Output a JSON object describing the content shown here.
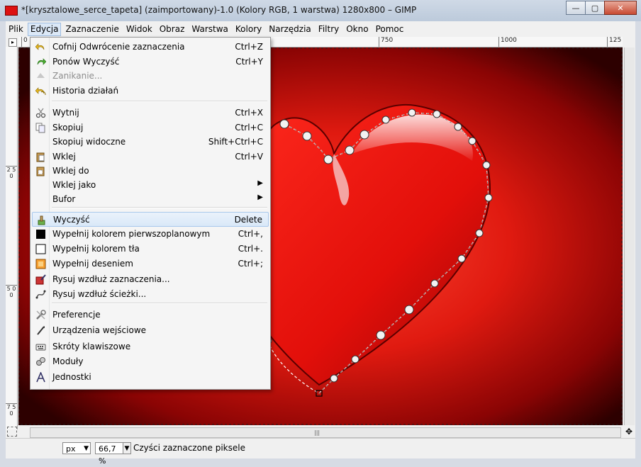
{
  "window": {
    "title": "*[krysztalowe_serce_tapeta] (zaimportowany)-1.0 (Kolory RGB, 1 warstwa) 1280x800 – GIMP",
    "buttons": {
      "minimize": "—",
      "maximize": "▢",
      "close": "✕"
    }
  },
  "menubar": [
    "Plik",
    "Edycja",
    "Zaznaczenie",
    "Widok",
    "Obraz",
    "Warstwa",
    "Kolory",
    "Narzędzia",
    "Filtry",
    "Okno",
    "Pomoc"
  ],
  "rulers": {
    "horizontal": [
      "0",
      "750",
      "1000",
      "125"
    ],
    "vertical": [
      "2 5 0",
      "5 0 0",
      "7 5 0"
    ]
  },
  "edit_menu": {
    "groups": [
      [
        {
          "label": "Cofnij Odwrócenie zaznaczenia",
          "shortcut": "Ctrl+Z",
          "icon": "undo-icon"
        },
        {
          "label": "Ponów Wyczyść",
          "shortcut": "Ctrl+Y",
          "icon": "redo-icon"
        },
        {
          "label": "Zanikanie...",
          "shortcut": "",
          "icon": "fade-icon",
          "disabled": true
        },
        {
          "label": "Historia działań",
          "shortcut": "",
          "icon": "history-icon"
        }
      ],
      [
        {
          "label": "Wytnij",
          "shortcut": "Ctrl+X",
          "icon": "cut-icon"
        },
        {
          "label": "Skopiuj",
          "shortcut": "Ctrl+C",
          "icon": "copy-icon"
        },
        {
          "label": "Skopiuj widoczne",
          "shortcut": "Shift+Ctrl+C",
          "icon": ""
        },
        {
          "label": "Wklej",
          "shortcut": "Ctrl+V",
          "icon": "paste-icon"
        },
        {
          "label": "Wklej do",
          "shortcut": "",
          "icon": "paste-into-icon"
        },
        {
          "label": "Wklej jako",
          "shortcut": "",
          "icon": "",
          "submenu": true
        },
        {
          "label": "Bufor",
          "shortcut": "",
          "icon": "",
          "submenu": true
        }
      ],
      [
        {
          "label": "Wyczyść",
          "shortcut": "Delete",
          "icon": "clear-icon",
          "highlighted": true
        },
        {
          "label": "Wypełnij kolorem pierwszoplanowym",
          "shortcut": "Ctrl+,",
          "icon": "fill-fg-icon"
        },
        {
          "label": "Wypełnij kolorem tła",
          "shortcut": "Ctrl+.",
          "icon": "fill-bg-icon"
        },
        {
          "label": "Wypełnij deseniem",
          "shortcut": "Ctrl+;",
          "icon": "fill-pattern-icon"
        },
        {
          "label": "Rysuj wzdłuż zaznaczenia...",
          "shortcut": "",
          "icon": "stroke-selection-icon"
        },
        {
          "label": "Rysuj wzdłuż ścieżki...",
          "shortcut": "",
          "icon": "stroke-path-icon"
        }
      ],
      [
        {
          "label": "Preferencje",
          "shortcut": "",
          "icon": "preferences-icon"
        },
        {
          "label": "Urządzenia wejściowe",
          "shortcut": "",
          "icon": "input-devices-icon"
        },
        {
          "label": "Skróty klawiszowe",
          "shortcut": "",
          "icon": "keyboard-icon"
        },
        {
          "label": "Moduły",
          "shortcut": "",
          "icon": "modules-icon"
        },
        {
          "label": "Jednostki",
          "shortcut": "",
          "icon": "units-icon"
        }
      ]
    ]
  },
  "statusbar": {
    "unit": "px",
    "zoom": "66,7 %",
    "message": "Czyści zaznaczone piksele"
  },
  "colors": {
    "heart": "#e01010",
    "background_center": "#ff3a2a",
    "background_edge": "#300000",
    "highlight": "#d9e8f8"
  }
}
